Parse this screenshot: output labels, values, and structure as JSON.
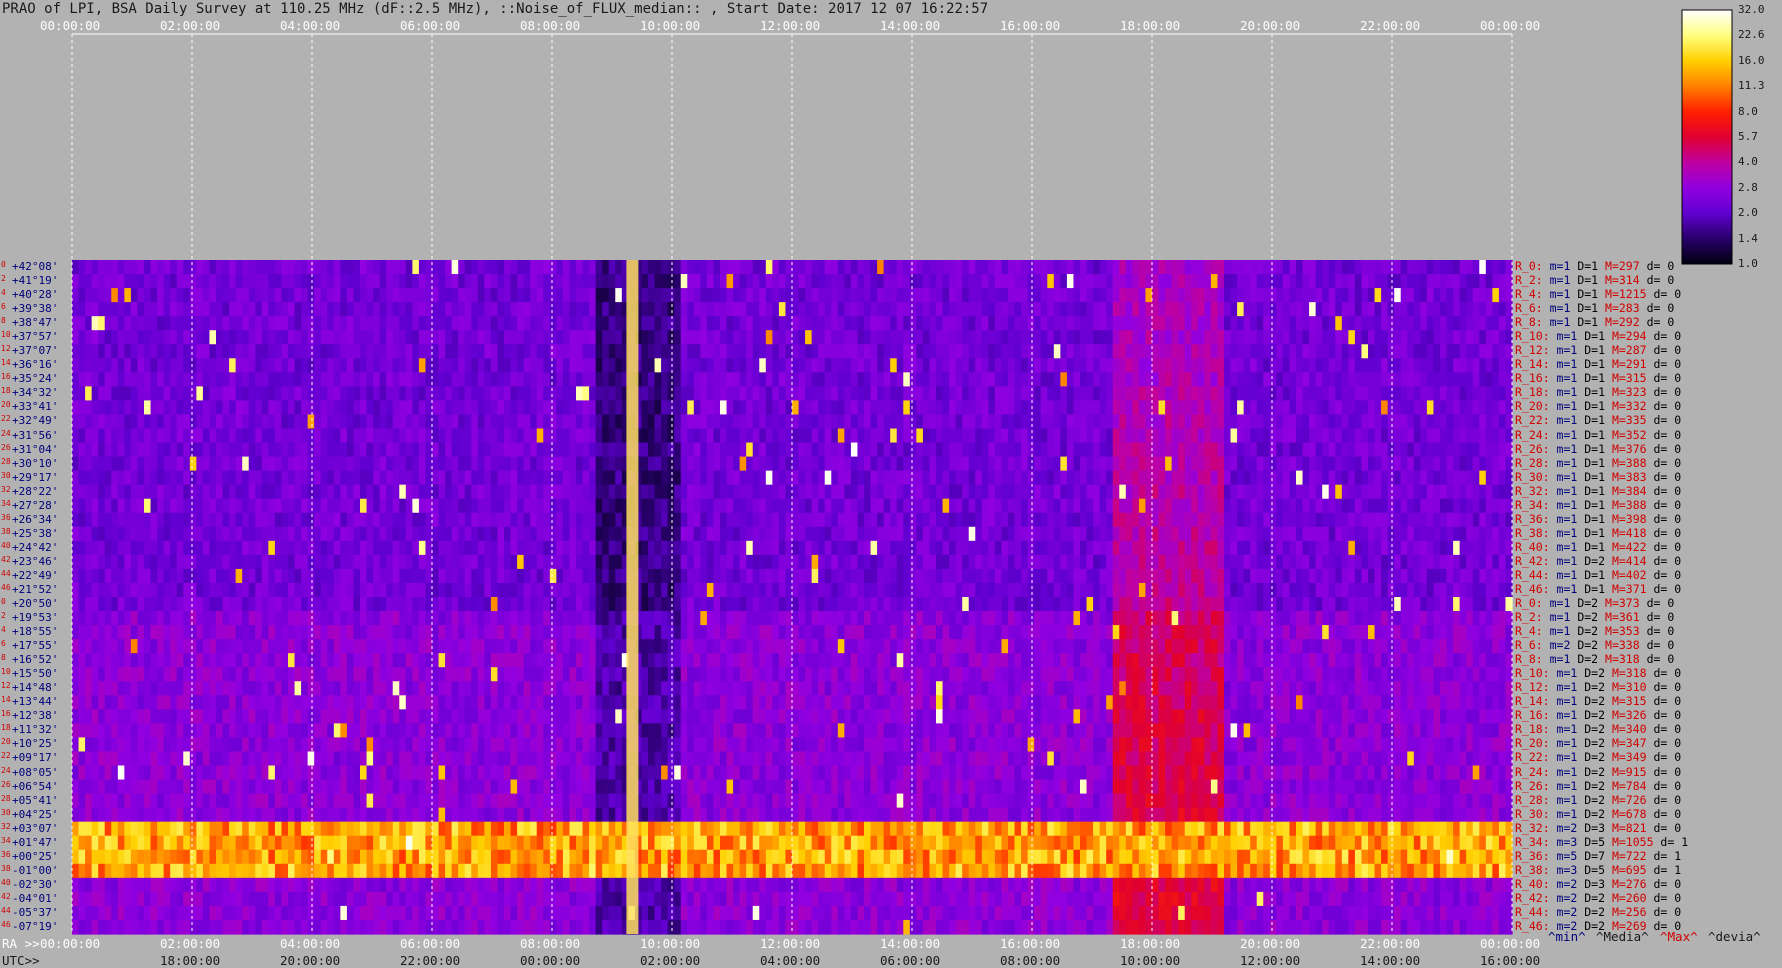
{
  "title": "PRAO of LPI, BSA Daily Survey at 110.25 MHz (dF::2.5 MHz), ::Noise_of_FLUX_median:: , Start Date: 2017 12 07 16:22:57",
  "top_axis_ticks": [
    "00:00:00",
    "02:00:00",
    "04:00:00",
    "06:00:00",
    "08:00:00",
    "10:00:00",
    "12:00:00",
    "14:00:00",
    "16:00:00",
    "18:00:00",
    "20:00:00",
    "22:00:00",
    "00:00:00"
  ],
  "ra_axis": {
    "prefix": "RA >>",
    "ticks": [
      "00:00:00",
      "02:00:00",
      "04:00:00",
      "06:00:00",
      "08:00:00",
      "10:00:00",
      "12:00:00",
      "14:00:00",
      "16:00:00",
      "18:00:00",
      "20:00:00",
      "22:00:00",
      "00:00:00"
    ]
  },
  "utc_axis": {
    "prefix": "UTC>>",
    "ticks": [
      "18:00:00",
      "20:00:00",
      "22:00:00",
      "00:00:00",
      "02:00:00",
      "04:00:00",
      "06:00:00",
      "08:00:00",
      "10:00:00",
      "12:00:00",
      "14:00:00",
      "16:00:00"
    ]
  },
  "stat_labels": [
    "^min^",
    "^Media^",
    "^Max^",
    "^devia^"
  ],
  "colorbar": {
    "labels": [
      "32.0",
      "22.6",
      "16.0",
      "11.3",
      "8.0",
      "5.7",
      "4.0",
      "2.8",
      "2.0",
      "1.4",
      "1.0"
    ],
    "colors": [
      "#ffffff",
      "#ffff80",
      "#ffd000",
      "#ff8000",
      "#ff2000",
      "#e00030",
      "#c000a0",
      "#9000e0",
      "#6000d0",
      "#28006a",
      "#000010"
    ]
  },
  "chart_data": {
    "type": "heatmap",
    "title": "PRAO of LPI, BSA Daily Survey at 110.25 MHz (dF::2.5 MHz), ::Noise_of_FLUX_median:: , Start Date: 2017 12 07 16:22:57",
    "x_axis": "RA (sidereal time) 00:00:00 to 24:00:00",
    "rows": [
      {
        "idx": "0",
        "dec": "+42°08'",
        "info": {
          "r": "R_0:",
          "m": "m=1",
          "D": "D=1",
          "M": "M=297",
          "d": "d= 0"
        }
      },
      {
        "idx": "2",
        "dec": "+41°19'",
        "info": {
          "r": "R_2:",
          "m": "m=1",
          "D": "D=1",
          "M": "M=314",
          "d": "d= 0"
        }
      },
      {
        "idx": "4",
        "dec": "+40°28'",
        "info": {
          "r": "R_4:",
          "m": "m=1",
          "D": "D=1",
          "M": "M=1215",
          "d": "d= 0"
        }
      },
      {
        "idx": "6",
        "dec": "+39°38'",
        "info": {
          "r": "R_6:",
          "m": "m=1",
          "D": "D=1",
          "M": "M=283",
          "d": "d= 0"
        }
      },
      {
        "idx": "8",
        "dec": "+38°47'",
        "info": {
          "r": "R_8:",
          "m": "m=1",
          "D": "D=1",
          "M": "M=292",
          "d": "d= 0"
        }
      },
      {
        "idx": "10",
        "dec": "+37°57'",
        "info": {
          "r": "R_10:",
          "m": "m=1",
          "D": "D=1",
          "M": "M=294",
          "d": "d= 0"
        }
      },
      {
        "idx": "12",
        "dec": "+37°07'",
        "info": {
          "r": "R_12:",
          "m": "m=1",
          "D": "D=1",
          "M": "M=287",
          "d": "d= 0"
        }
      },
      {
        "idx": "14",
        "dec": "+36°16'",
        "info": {
          "r": "R_14:",
          "m": "m=1",
          "D": "D=1",
          "M": "M=291",
          "d": "d= 0"
        }
      },
      {
        "idx": "16",
        "dec": "+35°24'",
        "info": {
          "r": "R_16:",
          "m": "m=1",
          "D": "D=1",
          "M": "M=315",
          "d": "d= 0"
        }
      },
      {
        "idx": "18",
        "dec": "+34°32'",
        "info": {
          "r": "R_18:",
          "m": "m=1",
          "D": "D=1",
          "M": "M=323",
          "d": "d= 0"
        }
      },
      {
        "idx": "20",
        "dec": "+33°41'",
        "info": {
          "r": "R_20:",
          "m": "m=1",
          "D": "D=1",
          "M": "M=332",
          "d": "d= 0"
        }
      },
      {
        "idx": "22",
        "dec": "+32°49'",
        "info": {
          "r": "R_22:",
          "m": "m=1",
          "D": "D=1",
          "M": "M=335",
          "d": "d= 0"
        }
      },
      {
        "idx": "24",
        "dec": "+31°56'",
        "info": {
          "r": "R_24:",
          "m": "m=1",
          "D": "D=1",
          "M": "M=352",
          "d": "d= 0"
        }
      },
      {
        "idx": "26",
        "dec": "+31°04'",
        "info": {
          "r": "R_26:",
          "m": "m=1",
          "D": "D=1",
          "M": "M=376",
          "d": "d= 0"
        }
      },
      {
        "idx": "28",
        "dec": "+30°10'",
        "info": {
          "r": "R_28:",
          "m": "m=1",
          "D": "D=1",
          "M": "M=388",
          "d": "d= 0"
        }
      },
      {
        "idx": "30",
        "dec": "+29°17'",
        "info": {
          "r": "R_30:",
          "m": "m=1",
          "D": "D=1",
          "M": "M=383",
          "d": "d= 0"
        }
      },
      {
        "idx": "32",
        "dec": "+28°22'",
        "info": {
          "r": "R_32:",
          "m": "m=1",
          "D": "D=1",
          "M": "M=384",
          "d": "d= 0"
        }
      },
      {
        "idx": "34",
        "dec": "+27°28'",
        "info": {
          "r": "R_34:",
          "m": "m=1",
          "D": "D=1",
          "M": "M=388",
          "d": "d= 0"
        }
      },
      {
        "idx": "36",
        "dec": "+26°34'",
        "info": {
          "r": "R_36:",
          "m": "m=1",
          "D": "D=1",
          "M": "M=398",
          "d": "d= 0"
        }
      },
      {
        "idx": "38",
        "dec": "+25°38'",
        "info": {
          "r": "R_38:",
          "m": "m=1",
          "D": "D=1",
          "M": "M=418",
          "d": "d= 0"
        }
      },
      {
        "idx": "40",
        "dec": "+24°42'",
        "info": {
          "r": "R_40:",
          "m": "m=1",
          "D": "D=1",
          "M": "M=422",
          "d": "d= 0"
        }
      },
      {
        "idx": "42",
        "dec": "+23°46'",
        "info": {
          "r": "R_42:",
          "m": "m=1",
          "D": "D=2",
          "M": "M=414",
          "d": "d= 0"
        }
      },
      {
        "idx": "44",
        "dec": "+22°49'",
        "info": {
          "r": "R_44:",
          "m": "m=1",
          "D": "D=1",
          "M": "M=402",
          "d": "d= 0"
        }
      },
      {
        "idx": "46",
        "dec": "+21°52'",
        "info": {
          "r": "R_46:",
          "m": "m=1",
          "D": "D=1",
          "M": "M=371",
          "d": "d= 0"
        }
      },
      {
        "idx": "0",
        "dec": "+20°50'",
        "info": {
          "r": "R_0:",
          "m": "m=1",
          "D": "D=2",
          "M": "M=373",
          "d": "d= 0"
        }
      },
      {
        "idx": "2",
        "dec": "+19°53'",
        "info": {
          "r": "R_2:",
          "m": "m=1",
          "D": "D=2",
          "M": "M=361",
          "d": "d= 0"
        }
      },
      {
        "idx": "4",
        "dec": "+18°55'",
        "info": {
          "r": "R_4:",
          "m": "m=1",
          "D": "D=2",
          "M": "M=353",
          "d": "d= 0"
        }
      },
      {
        "idx": "6",
        "dec": "+17°55'",
        "info": {
          "r": "R_6:",
          "m": "m=2",
          "D": "D=2",
          "M": "M=338",
          "d": "d= 0"
        }
      },
      {
        "idx": "8",
        "dec": "+16°52'",
        "info": {
          "r": "R_8:",
          "m": "m=1",
          "D": "D=2",
          "M": "M=318",
          "d": "d= 0"
        }
      },
      {
        "idx": "10",
        "dec": "+15°50'",
        "info": {
          "r": "R_10:",
          "m": "m=1",
          "D": "D=2",
          "M": "M=318",
          "d": "d= 0"
        }
      },
      {
        "idx": "12",
        "dec": "+14°48'",
        "info": {
          "r": "R_12:",
          "m": "m=1",
          "D": "D=2",
          "M": "M=310",
          "d": "d= 0"
        }
      },
      {
        "idx": "14",
        "dec": "+13°44'",
        "info": {
          "r": "R_14:",
          "m": "m=1",
          "D": "D=2",
          "M": "M=315",
          "d": "d= 0"
        }
      },
      {
        "idx": "16",
        "dec": "+12°38'",
        "info": {
          "r": "R_16:",
          "m": "m=1",
          "D": "D=2",
          "M": "M=326",
          "d": "d= 0"
        }
      },
      {
        "idx": "18",
        "dec": "+11°32'",
        "info": {
          "r": "R_18:",
          "m": "m=1",
          "D": "D=2",
          "M": "M=340",
          "d": "d= 0"
        }
      },
      {
        "idx": "20",
        "dec": "+10°25'",
        "info": {
          "r": "R_20:",
          "m": "m=1",
          "D": "D=2",
          "M": "M=347",
          "d": "d= 0"
        }
      },
      {
        "idx": "22",
        "dec": "+09°17'",
        "info": {
          "r": "R_22:",
          "m": "m=1",
          "D": "D=2",
          "M": "M=349",
          "d": "d= 0"
        }
      },
      {
        "idx": "24",
        "dec": "+08°05'",
        "info": {
          "r": "R_24:",
          "m": "m=1",
          "D": "D=2",
          "M": "M=915",
          "d": "d= 0"
        }
      },
      {
        "idx": "26",
        "dec": "+06°54'",
        "info": {
          "r": "R_26:",
          "m": "m=1",
          "D": "D=2",
          "M": "M=784",
          "d": "d= 0"
        }
      },
      {
        "idx": "28",
        "dec": "+05°41'",
        "info": {
          "r": "R_28:",
          "m": "m=1",
          "D": "D=2",
          "M": "M=726",
          "d": "d= 0"
        }
      },
      {
        "idx": "30",
        "dec": "+04°25'",
        "info": {
          "r": "R_30:",
          "m": "m=1",
          "D": "D=2",
          "M": "M=678",
          "d": "d= 0"
        }
      },
      {
        "idx": "32",
        "dec": "+03°07'",
        "info": {
          "r": "R_32:",
          "m": "m=2",
          "D": "D=3",
          "M": "M=821",
          "d": "d= 0"
        }
      },
      {
        "idx": "34",
        "dec": "+01°47'",
        "info": {
          "r": "R_34:",
          "m": "m=3",
          "D": "D=5",
          "M": "M=1055",
          "d": "d= 1"
        }
      },
      {
        "idx": "36",
        "dec": "+00°25'",
        "info": {
          "r": "R_36:",
          "m": "m=5",
          "D": "D=7",
          "M": "M=722",
          "d": "d= 1"
        }
      },
      {
        "idx": "38",
        "dec": "-01°00'",
        "info": {
          "r": "R_38:",
          "m": "m=3",
          "D": "D=5",
          "M": "M=695",
          "d": "d= 1"
        }
      },
      {
        "idx": "40",
        "dec": "-02°30'",
        "info": {
          "r": "R_40:",
          "m": "m=2",
          "D": "D=3",
          "M": "M=276",
          "d": "d= 0"
        }
      },
      {
        "idx": "42",
        "dec": "-04°01'",
        "info": {
          "r": "R_42:",
          "m": "m=2",
          "D": "D=2",
          "M": "M=260",
          "d": "d= 0"
        }
      },
      {
        "idx": "44",
        "dec": "-05°37'",
        "info": {
          "r": "R_44:",
          "m": "m=2",
          "D": "D=2",
          "M": "M=256",
          "d": "d= 0"
        }
      },
      {
        "idx": "46",
        "dec": "-07°19'",
        "info": {
          "r": "R_46:",
          "m": "m=2",
          "D": "D=2",
          "M": "M=269",
          "d": "d= 0"
        }
      }
    ]
  }
}
